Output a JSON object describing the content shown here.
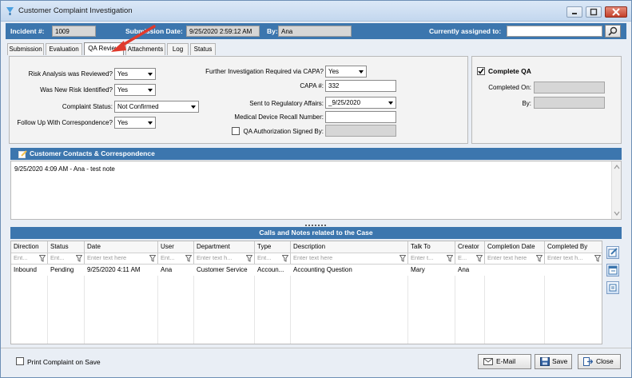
{
  "window": {
    "title": "Customer Complaint Investigation"
  },
  "header": {
    "incident_label": "Incident #:",
    "incident_value": "1009",
    "submission_label": "Submission Date:",
    "submission_value": "9/25/2020 2:59:12 AM",
    "by_label": "By:",
    "by_value": "Ana",
    "assigned_label": "Currently assigned to:",
    "assigned_value": ""
  },
  "tabs": [
    {
      "label": "Submission"
    },
    {
      "label": "Evaluation"
    },
    {
      "label": "QA Review"
    },
    {
      "label": "Attachments"
    },
    {
      "label": "Log"
    },
    {
      "label": "Status"
    }
  ],
  "active_tab": "QA Review",
  "qa_form": {
    "risk_reviewed_label": "Risk Analysis was Reviewed?",
    "risk_reviewed_value": "Yes",
    "new_risk_label": "Was New Risk Identified?",
    "new_risk_value": "Yes",
    "complaint_status_label": "Complaint Status:",
    "complaint_status_value": "Not Confirmed",
    "follow_up_label": "Follow Up With Correspondence?",
    "follow_up_value": "Yes",
    "capa_required_label": "Further Investigation Required via CAPA?",
    "capa_required_value": "Yes",
    "capa_number_label": "CAPA #:",
    "capa_number_value": "332",
    "sent_regulatory_label": "Sent to Regulatory Affairs:",
    "sent_regulatory_value": "_9/25/2020",
    "recall_label": "Medical Device Recall Number:",
    "recall_value": "",
    "qa_auth_label": "QA Authorization Signed By:",
    "qa_auth_value": ""
  },
  "complete_qa": {
    "label": "Complete QA",
    "checked": true,
    "completed_on_label": "Completed On:",
    "completed_on_value": "",
    "by_label": "By:",
    "by_value": ""
  },
  "contacts": {
    "title": "Customer Contacts & Correspondence",
    "note": "9/25/2020 4:09 AM - Ana - test note"
  },
  "calls": {
    "title": "Calls and Notes related to the Case",
    "columns": [
      {
        "header": "Direction",
        "filter": "Ent..."
      },
      {
        "header": "Status",
        "filter": "Ent..."
      },
      {
        "header": "Date",
        "filter": "Enter text here"
      },
      {
        "header": "User",
        "filter": "Ent..."
      },
      {
        "header": "Department",
        "filter": "Enter text h..."
      },
      {
        "header": "Type",
        "filter": "Ent..."
      },
      {
        "header": "Description",
        "filter": "Enter text here"
      },
      {
        "header": "Talk To",
        "filter": "Enter t..."
      },
      {
        "header": "Creator",
        "filter": "E..."
      },
      {
        "header": "Completion Date",
        "filter": "Enter text here"
      },
      {
        "header": "Completed By",
        "filter": "Enter text h..."
      }
    ],
    "rows": [
      [
        "Inbound",
        "Pending",
        "9/25/2020 4:11 AM",
        "Ana",
        "Customer Service",
        "Accoun...",
        "Accounting Question",
        "Mary",
        "Ana",
        "",
        ""
      ]
    ]
  },
  "footer": {
    "print_label": "Print Complaint on Save",
    "email_label": "E-Mail",
    "save_label": "Save",
    "close_label": "Close"
  },
  "colors": {
    "accent": "#3c76ae",
    "annotation_arrow": "#e03a2c"
  }
}
